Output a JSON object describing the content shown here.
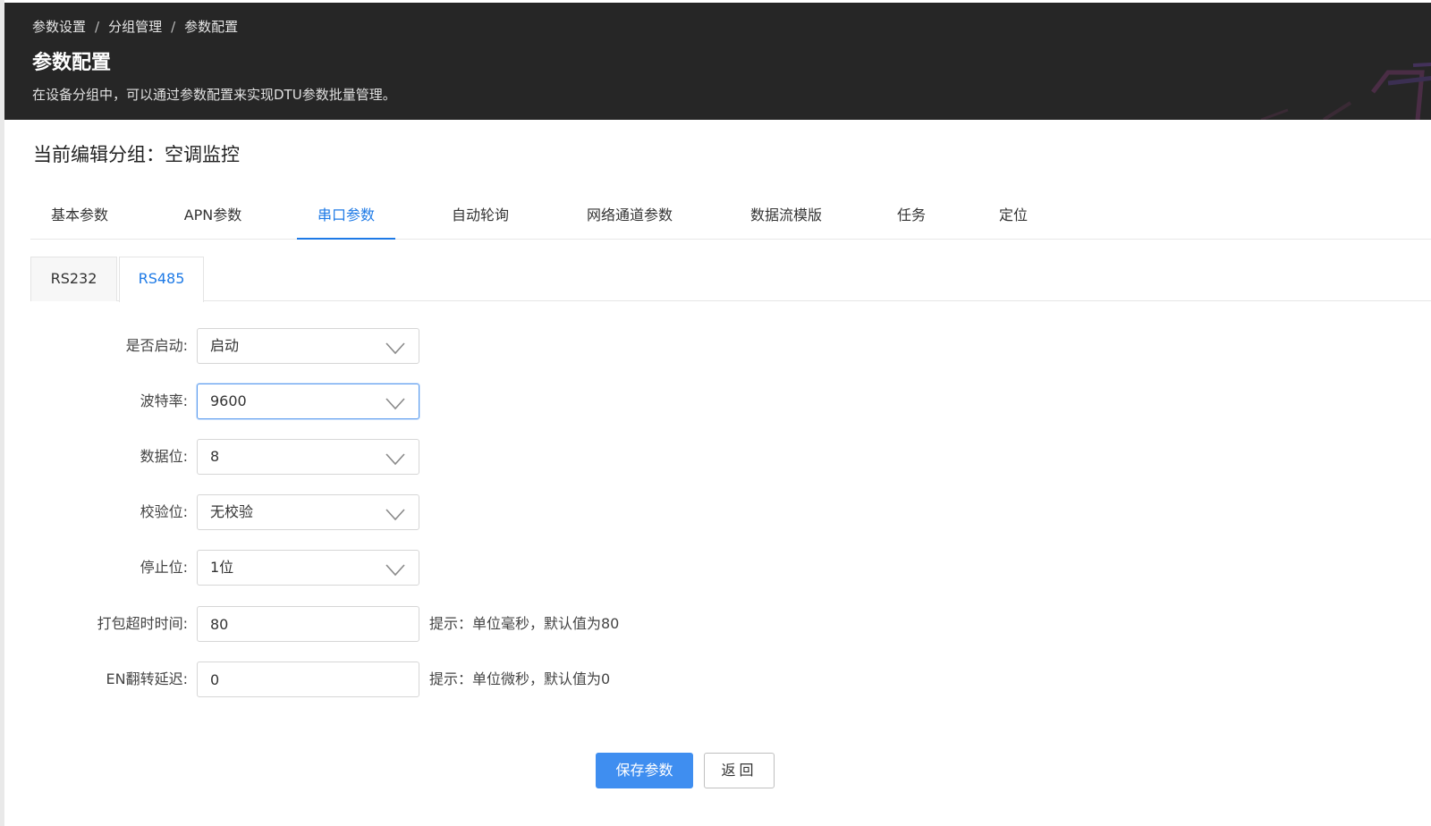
{
  "header": {
    "breadcrumb": [
      "参数设置",
      "分组管理",
      "参数配置"
    ],
    "separator": "/",
    "title": "参数配置",
    "description": "在设备分组中，可以通过参数配置来实现DTU参数批量管理。"
  },
  "group_title": "当前编辑分组：空调监控",
  "main_tabs": [
    {
      "label": "基本参数",
      "active": false
    },
    {
      "label": "APN参数",
      "active": false
    },
    {
      "label": "串口参数",
      "active": true
    },
    {
      "label": "自动轮询",
      "active": false
    },
    {
      "label": "网络通道参数",
      "active": false
    },
    {
      "label": "数据流模版",
      "active": false
    },
    {
      "label": "任务",
      "active": false
    },
    {
      "label": "定位",
      "active": false
    }
  ],
  "sub_tabs": [
    {
      "label": "RS232",
      "active": false
    },
    {
      "label": "RS485",
      "active": true
    }
  ],
  "form": {
    "enabled": {
      "label": "是否启动:",
      "value": "启动"
    },
    "baud_rate": {
      "label": "波特率:",
      "value": "9600"
    },
    "data_bits": {
      "label": "数据位:",
      "value": "8"
    },
    "parity": {
      "label": "校验位:",
      "value": "无校验"
    },
    "stop_bits": {
      "label": "停止位:",
      "value": "1位"
    },
    "pack_timeout": {
      "label": "打包超时时间:",
      "value": "80",
      "hint": "提示：单位毫秒，默认值为80"
    },
    "en_delay": {
      "label": "EN翻转延迟:",
      "value": "0",
      "hint": "提示：单位微秒，默认值为0"
    }
  },
  "buttons": {
    "save": "保存参数",
    "back": "返回"
  },
  "colors": {
    "accent": "#1e7ae6",
    "primary_button": "#3f8ef0",
    "header_bg": "#262626"
  }
}
